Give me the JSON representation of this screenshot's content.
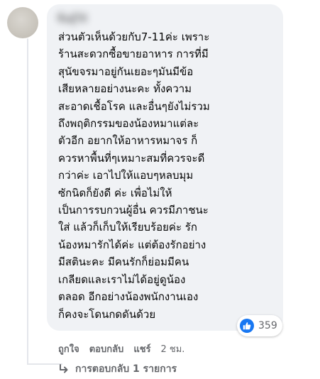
{
  "comment": {
    "author_name": "ชื่อผู้ใช้",
    "text_lines": [
      "ส่วนตัวเห็นด้วยกับ7-11ค่ะ เพราะ",
      "ร้านสะดวกซื้อขายอาหาร การที่มี",
      "สุนัขจรมาอยู่กันเยอะๆมันมีข้อ",
      "เสียหลายอย่างนะคะ ทั้งความ",
      "สะอาดเชื้อโรค และอื่นๆยังไม่รวม",
      "ถึงพฤติกรรมของน้องหมาแต่ละ",
      "ตัวอีก อยากให้อาหารหมาจร ก็",
      "ควรหาพื้นที่ๆเหมาะสมที่ควรจะดี",
      "กว่าค่ะ เอาไปให้แอบๆหลบมุม",
      "ซักนิดก็ยังดี ค่ะ เพื่อไม่ให้",
      "เป็นการรบกวนผู้อื่น ควรมีภาชนะ",
      "ใส่ แล้วก็เก็บให้เรียบร้อยค่ะ รัก",
      "น้องหมารักได้ค่ะ แต่ต้องรักอย่าง",
      "มีสตินะคะ มีคนรักก็ย่อมมีคน",
      "เกลียดและเราไม่ได้อยู่ดูน้อง",
      "ตลอด อีกอย่างน้องพนักงานเอง",
      "ก็คงจะโดนกดดันด้วย"
    ],
    "reaction_count": "359",
    "like_color": "#1877f2"
  },
  "actions": {
    "like": "ถูกใจ",
    "reply": "ตอบกลับ",
    "share": "แชร์",
    "time": "2 ชม."
  },
  "replies": {
    "label": "การตอบกลับ 1 รายการ"
  }
}
